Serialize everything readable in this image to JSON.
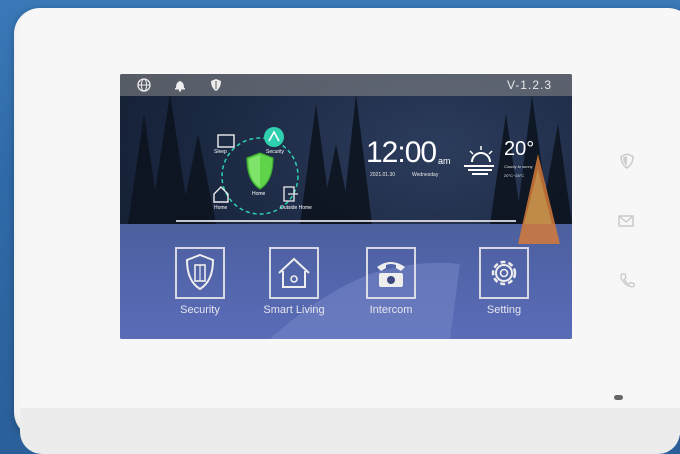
{
  "screen": {
    "status_bar": {
      "icons": [
        "globe-icon",
        "bell-icon",
        "shield-icon"
      ],
      "version": "V-1.2.3"
    },
    "security_ring": {
      "labels": {
        "top_left": "Sleep",
        "top_right": "Security",
        "center": "Home",
        "bottom_left": "Home",
        "bottom_right": "Outside Home"
      }
    },
    "clock": {
      "time": "12:00",
      "ampm": "am",
      "date": "2021.01.30",
      "weekday": "Wednesday"
    },
    "weather": {
      "icon": "partly-cloudy-icon",
      "temperature": "20°",
      "condition": "Cloudy to sunny",
      "range": "20°C~28°C"
    },
    "tiles": [
      {
        "label": "Security",
        "icon": "building-shield-icon"
      },
      {
        "label": "Smart Living",
        "icon": "smart-home-icon"
      },
      {
        "label": "Intercom",
        "icon": "telephone-icon"
      },
      {
        "label": "Setting",
        "icon": "gear-icon"
      }
    ]
  },
  "device_buttons": [
    "shield-icon",
    "mail-icon",
    "phone-icon"
  ],
  "colors": {
    "frame": "#f7f7f7",
    "accent_green": "#5fd34a",
    "ring_teal": "#2fd0b0",
    "text": "#ffffff"
  }
}
